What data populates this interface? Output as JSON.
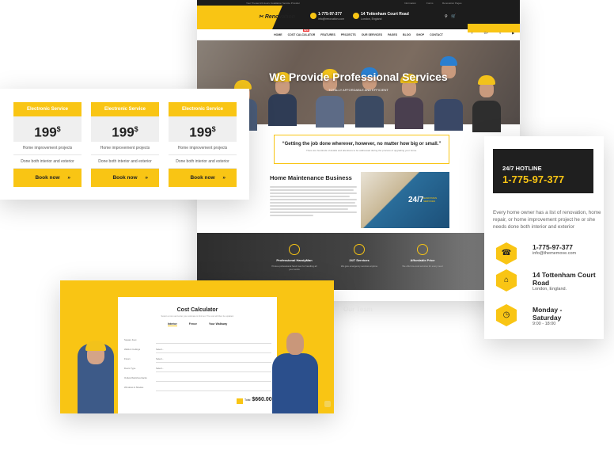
{
  "site": {
    "topbar": {
      "left": "Your Trusted 24 Hours Installation Service Provider",
      "links": [
        "Information",
        "Forms",
        "Renovation Pages"
      ]
    },
    "logo": "Renovation",
    "phone": {
      "number": "1-775-97-377",
      "email": "info@renovation.com"
    },
    "address": {
      "line1": "14 Tottenham Court Road",
      "line2": "London, England"
    },
    "nav": [
      "HOME",
      "COST CALCULATOR",
      "FEATURES",
      "PROJECTS",
      "OUR SERVICES",
      "PAGES",
      "BLOG",
      "SHOP",
      "CONTACT"
    ],
    "nav_badge": "NEW",
    "social": [
      "f",
      "G+",
      "t",
      "▶"
    ],
    "hero": {
      "title": "We Provide Professional Services",
      "subtitle": "TOTALLY AFFORDABLE AND EFFICIENT"
    },
    "quote": {
      "text": "“Getting the job done wherever, however, no matter how big or small.”",
      "sub": "There are hundreds of details and attentions to be addressed during the process of upgrading your home."
    },
    "home_maintenance": {
      "title": "Home Maintenance Business"
    },
    "banner": {
      "big": "24/7",
      "small1": "HANDYMAN",
      "small2": "SERVICES"
    },
    "features": [
      {
        "title": "Professional HandyMan",
        "text": "Pursue professional hand man for handling all your works"
      },
      {
        "title": "24/7 Services",
        "text": "We give emergency services anytime"
      },
      {
        "title": "Affordable Price",
        "text": "We offer low-cost services for every need"
      }
    ],
    "our_team": "Our Team"
  },
  "pricing": {
    "cards": [
      {
        "title": "Electronic Service",
        "price": "199",
        "currency": "$",
        "line1": "Home improvement projects",
        "line2": "Done both interior and exterior",
        "button": "Book now",
        "arrow": "»"
      },
      {
        "title": "Electronic Service",
        "price": "199",
        "currency": "$",
        "line1": "Home improvement projects",
        "line2": "Done both interior and exterior",
        "button": "Book now",
        "arrow": "»"
      },
      {
        "title": "Electronic Service",
        "price": "199",
        "currency": "$",
        "line1": "Home improvement projects",
        "line2": "Done both interior and exterior",
        "button": "Book now",
        "arrow": "»"
      }
    ]
  },
  "hotline": {
    "label": "24/7 HOTLINE",
    "number": "1-775-97-377",
    "desc": "Every home owner has a list of renovation, home repair, or home improvement project he or she needs done both interior and exterior",
    "items": [
      {
        "icon": "phone-icon",
        "glyph": "☎",
        "title": "1-775-97-377",
        "sub": "info@thememove.com"
      },
      {
        "icon": "home-icon",
        "glyph": "⌂",
        "title": "14 Tottenham Court Road",
        "sub": "London, England."
      },
      {
        "icon": "clock-icon",
        "glyph": "◷",
        "title": "Monday - Saturday",
        "sub": "9:00 - 18:00"
      }
    ]
  },
  "calculator": {
    "title": "Cost Calculator",
    "desc": "Select a room and enter your estimate to find out. The cost will then be updated.",
    "tabs": [
      "Interior",
      "Fence",
      "Your Walkway"
    ],
    "rows": [
      "Square Feet",
      "Walls & Ceilings",
      "Floors",
      "Doors Type",
      "Outlets/Switches/Jacks",
      "Windows & Shades"
    ],
    "select_placeholder": "Select...",
    "total_label": "Total",
    "total": "$660.00"
  },
  "colors": {
    "accent": "#f9c514",
    "dark": "#1c1c1c"
  }
}
